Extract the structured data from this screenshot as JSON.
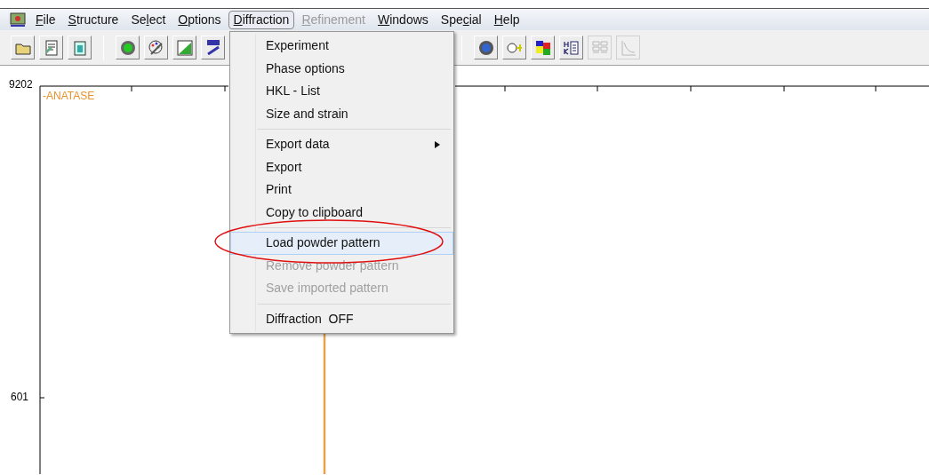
{
  "menu_bar": [
    {
      "key": "F",
      "after": "ile",
      "selected": false,
      "disabled": false
    },
    {
      "key": "S",
      "after": "tructure",
      "selected": false,
      "disabled": false
    },
    {
      "before": "Se",
      "key": "l",
      "after": "ect",
      "selected": false,
      "disabled": false
    },
    {
      "key": "O",
      "after": "ptions",
      "selected": false,
      "disabled": false
    },
    {
      "key": "D",
      "after": "iffraction",
      "selected": true,
      "disabled": false
    },
    {
      "key": "R",
      "after": "efinement",
      "selected": false,
      "disabled": true
    },
    {
      "key": "W",
      "after": "indows",
      "selected": false,
      "disabled": false
    },
    {
      "before": "Spe",
      "key": "c",
      "after": "ial",
      "selected": false,
      "disabled": false
    },
    {
      "key": "H",
      "after": "elp",
      "selected": false,
      "disabled": false
    }
  ],
  "toolbar_left": [
    {
      "kind": "folder",
      "disabled": false
    },
    {
      "kind": "document",
      "disabled": false
    },
    {
      "kind": "notepad",
      "disabled": false
    },
    {
      "kind": "separator"
    },
    {
      "kind": "sphere",
      "disabled": false
    },
    {
      "kind": "palette",
      "disabled": false
    },
    {
      "kind": "xy",
      "disabled": false
    },
    {
      "kind": "edit",
      "disabled": false
    }
  ],
  "toolbar_right": [
    {
      "kind": "separator"
    },
    {
      "kind": "target",
      "disabled": false
    },
    {
      "kind": "bond",
      "disabled": false
    },
    {
      "kind": "colors",
      "disabled": false
    },
    {
      "kind": "hkl",
      "disabled": false
    },
    {
      "kind": "grid",
      "disabled": true
    },
    {
      "kind": "curve",
      "disabled": true
    }
  ],
  "dropdown": [
    {
      "kind": "item",
      "label": "Experiment",
      "disabled": false,
      "selected": false
    },
    {
      "kind": "item",
      "label": "Phase options",
      "disabled": false,
      "selected": false
    },
    {
      "kind": "item",
      "label": "HKL - List",
      "disabled": false,
      "selected": false
    },
    {
      "kind": "item",
      "label": "Size and strain",
      "disabled": false,
      "selected": false
    },
    {
      "kind": "separator"
    },
    {
      "kind": "submenu",
      "label": "Export data",
      "disabled": false,
      "selected": false
    },
    {
      "kind": "item",
      "label": "Export",
      "disabled": false,
      "selected": false
    },
    {
      "kind": "item",
      "label": "Print",
      "disabled": false,
      "selected": false
    },
    {
      "kind": "item",
      "label": "Copy to clipboard",
      "disabled": false,
      "selected": false
    },
    {
      "kind": "separator"
    },
    {
      "kind": "item",
      "label": "Load powder pattern",
      "disabled": false,
      "selected": true
    },
    {
      "kind": "item",
      "label": "Remove powder pattern",
      "disabled": true,
      "selected": false
    },
    {
      "kind": "item",
      "label": "Save imported pattern",
      "disabled": true,
      "selected": false
    },
    {
      "kind": "separator"
    },
    {
      "kind": "item",
      "label": "Diffraction  OFF",
      "disabled": false,
      "selected": false
    }
  ],
  "plot": {
    "y_labels": [
      "9202",
      "601"
    ],
    "series_label": "-ANATASE"
  }
}
